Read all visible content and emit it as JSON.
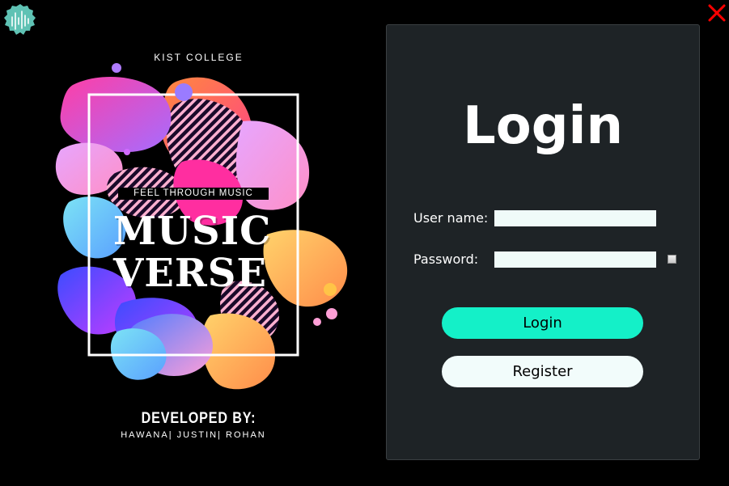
{
  "window": {
    "logo_icon": "waveform-badge-icon",
    "close_icon": "close-x-icon",
    "close_color": "#ff0000"
  },
  "poster": {
    "college": "KIST COLLEGE",
    "tagline": "FEEL THROUGH MUSIC",
    "title_line1": "MUSIC",
    "title_line2": "VERSE",
    "developed_by_label": "DEVELOPED BY:",
    "developers": "HAWANA| JUSTIN| ROHAN"
  },
  "login": {
    "heading": "Login",
    "username_label": "User name:",
    "username_value": "",
    "password_label": "Password:",
    "password_value": "",
    "login_button": "Login",
    "register_button": "Register",
    "accent_color": "#14f0c8",
    "panel_color": "#1e2326"
  }
}
